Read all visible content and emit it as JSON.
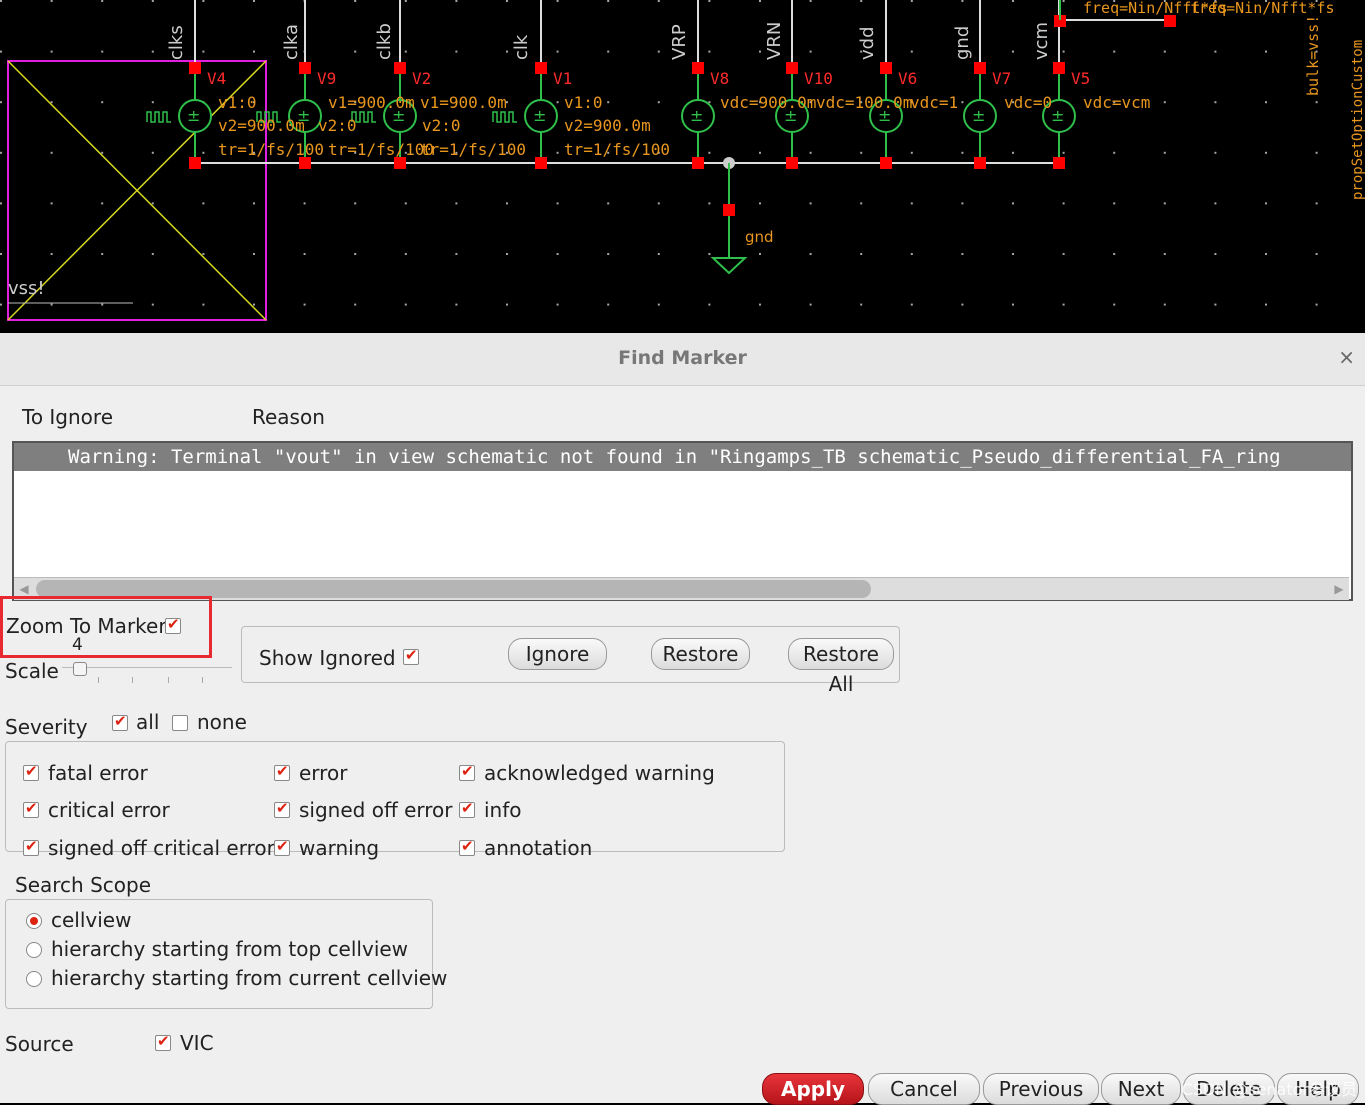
{
  "schematic": {
    "pin_labels": [
      "clks",
      "clka",
      "clkb",
      "clk",
      "VRP",
      "VRN",
      "vdd",
      "gnd",
      "vcm"
    ],
    "instances": [
      "V4",
      "V9",
      "V2",
      "V1",
      "V8",
      "V10",
      "V6",
      "V7",
      "V5"
    ],
    "params": {
      "v4_v1": "v1:0",
      "v4_v2": "v2=900.0m",
      "v4_tr": "tr=1/fs/100",
      "v9_v1": "v1=900.0m",
      "v9_v2": "v2:0",
      "v9_tr": "tr=1/fs/100",
      "v2_v1": "v1=900.0m",
      "v2_v2": "v2:0",
      "v2_tr": "tr=1/fs/100",
      "v1_v1": "v1:0",
      "v1_v2": "v2=900.0m",
      "v1_tr": "tr=1/fs/100",
      "v8_vdc": "vdc=900.0m",
      "v10_vdc": "vdc=100.0m",
      "v6_vdc": "vdc=1",
      "v7_vdc": "vdc=0",
      "v5_vdc": "vdc=vcm",
      "freq1": "freq=Nin/Nfft*fs",
      "freq2": "freq=Nin/Nfft*fs",
      "bulk": "bulk=vss!",
      "prop": "propSetOptionCustom",
      "gnd_label": "gnd",
      "vss_label": "vss!"
    }
  },
  "dialog": {
    "title": "Find Marker",
    "close_glyph": "×",
    "col_to_ignore": "To Ignore",
    "col_reason": "Reason",
    "marker_row": "Warning: Terminal \"vout\" in view schematic not found in \"Ringamps_TB schematic_Pseudo_differential_FA_ring",
    "zoom_to_marker": "Zoom To Marker",
    "zoom_checked": true,
    "scale_label": "Scale",
    "scale_value": "4",
    "show_ignored": "Show Ignored",
    "show_ignored_checked": true,
    "buttons": {
      "ignore": "Ignore",
      "restore": "Restore",
      "restore_all": "Restore All"
    },
    "severity_label": "Severity",
    "severity_all": "all",
    "severity_none": "none",
    "severity_items": [
      {
        "label": "fatal error",
        "checked": true
      },
      {
        "label": "critical error",
        "checked": true
      },
      {
        "label": "signed off critical error",
        "checked": true
      },
      {
        "label": "error",
        "checked": true
      },
      {
        "label": "signed off error",
        "checked": true
      },
      {
        "label": "warning",
        "checked": true
      },
      {
        "label": "acknowledged warning",
        "checked": true
      },
      {
        "label": "info",
        "checked": true
      },
      {
        "label": "annotation",
        "checked": true
      }
    ],
    "scope_label": "Search Scope",
    "scope_options": [
      {
        "label": "cellview",
        "selected": true
      },
      {
        "label": "hierarchy starting from top cellview",
        "selected": false
      },
      {
        "label": "hierarchy starting from current cellview",
        "selected": false
      }
    ],
    "source_label": "Source",
    "source_vic": "VIC",
    "footer": {
      "apply": "Apply",
      "cancel": "Cancel",
      "previous": "Previous",
      "next": "Next",
      "delete": "Delete",
      "help": "Help"
    },
    "watermark": "CSDN @senator参议员"
  },
  "colors": {
    "accent_red": "#e8292f",
    "schematic_orange": "#e8961e",
    "wire_green": "#2fbf4a",
    "pin_red": "#ff0000",
    "frame_magenta": "#e020e0"
  }
}
